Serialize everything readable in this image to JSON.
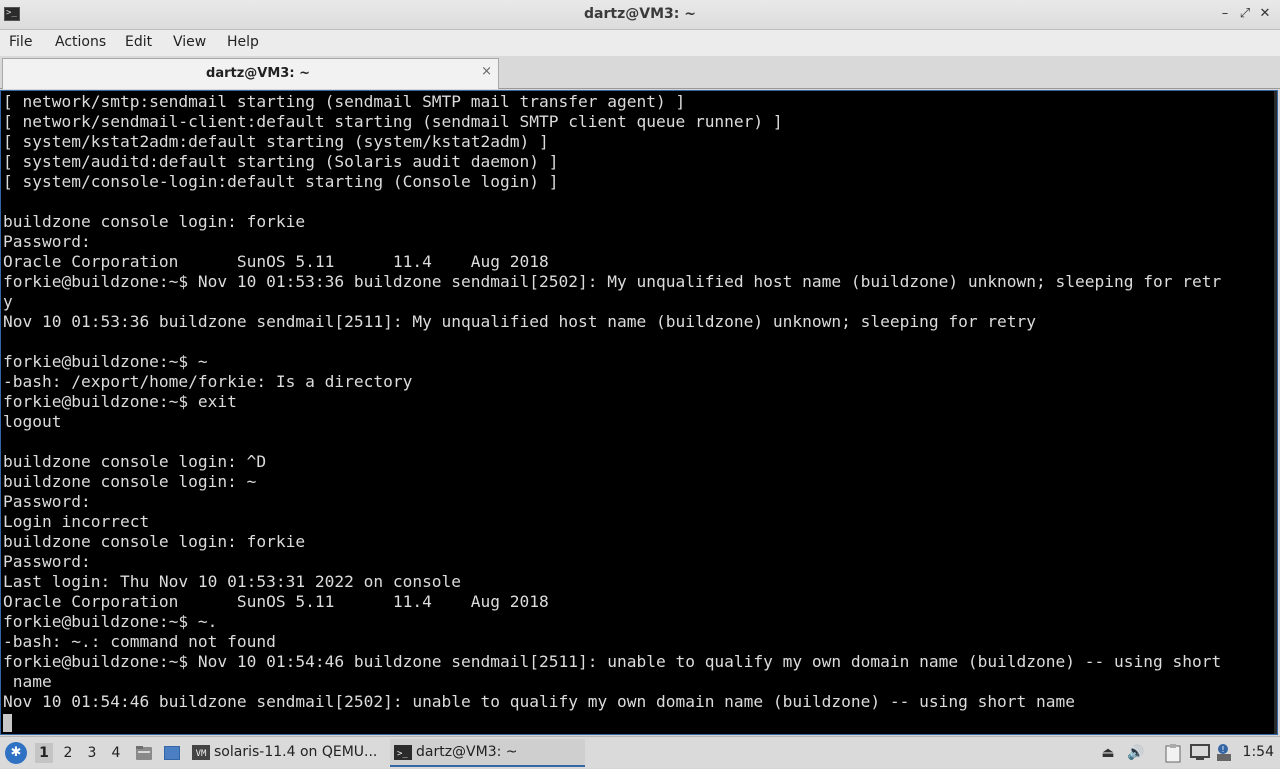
{
  "window": {
    "title": "dartz@VM3: ~",
    "controls": [
      "minimize-icon",
      "maximize-icon",
      "close-icon"
    ]
  },
  "menubar": {
    "items": [
      "File",
      "Actions",
      "Edit",
      "View",
      "Help"
    ]
  },
  "tabs": [
    {
      "label": "dartz@VM3: ~",
      "close": "×"
    }
  ],
  "terminal": {
    "lines": [
      "[ network/smtp:sendmail starting (sendmail SMTP mail transfer agent) ]",
      "[ network/sendmail-client:default starting (sendmail SMTP client queue runner) ]",
      "[ system/kstat2adm:default starting (system/kstat2adm) ]",
      "[ system/auditd:default starting (Solaris audit daemon) ]",
      "[ system/console-login:default starting (Console login) ]",
      "",
      "buildzone console login: forkie",
      "Password:",
      "Oracle Corporation      SunOS 5.11      11.4    Aug 2018",
      "forkie@buildzone:~$ Nov 10 01:53:36 buildzone sendmail[2502]: My unqualified host name (buildzone) unknown; sleeping for retr",
      "y",
      "Nov 10 01:53:36 buildzone sendmail[2511]: My unqualified host name (buildzone) unknown; sleeping for retry",
      "",
      "forkie@buildzone:~$ ~",
      "-bash: /export/home/forkie: Is a directory",
      "forkie@buildzone:~$ exit",
      "logout",
      "",
      "buildzone console login: ^D",
      "buildzone console login: ~",
      "Password:",
      "Login incorrect",
      "buildzone console login: forkie",
      "Password:",
      "Last login: Thu Nov 10 01:53:31 2022 on console",
      "Oracle Corporation      SunOS 5.11      11.4    Aug 2018",
      "forkie@buildzone:~$ ~.",
      "-bash: ~.: command not found",
      "forkie@buildzone:~$ Nov 10 01:54:46 buildzone sendmail[2511]: unable to qualify my own domain name (buildzone) -- using short",
      " name",
      "Nov 10 01:54:46 buildzone sendmail[2502]: unable to qualify my own domain name (buildzone) -- using short name"
    ]
  },
  "taskbar": {
    "workspaces": [
      "1",
      "2",
      "3",
      "4"
    ],
    "active_workspace": "1",
    "tasks": [
      {
        "label": "solaris-11.4 on QEMU...",
        "icon": "qemu-vm-icon"
      },
      {
        "label": "dartz@VM3: ~",
        "icon": "terminal-icon"
      }
    ],
    "clock": "1:54"
  },
  "colors": {
    "terminal_bg": "#000000",
    "terminal_fg": "#dcdcdc",
    "accent": "#3465a4"
  }
}
